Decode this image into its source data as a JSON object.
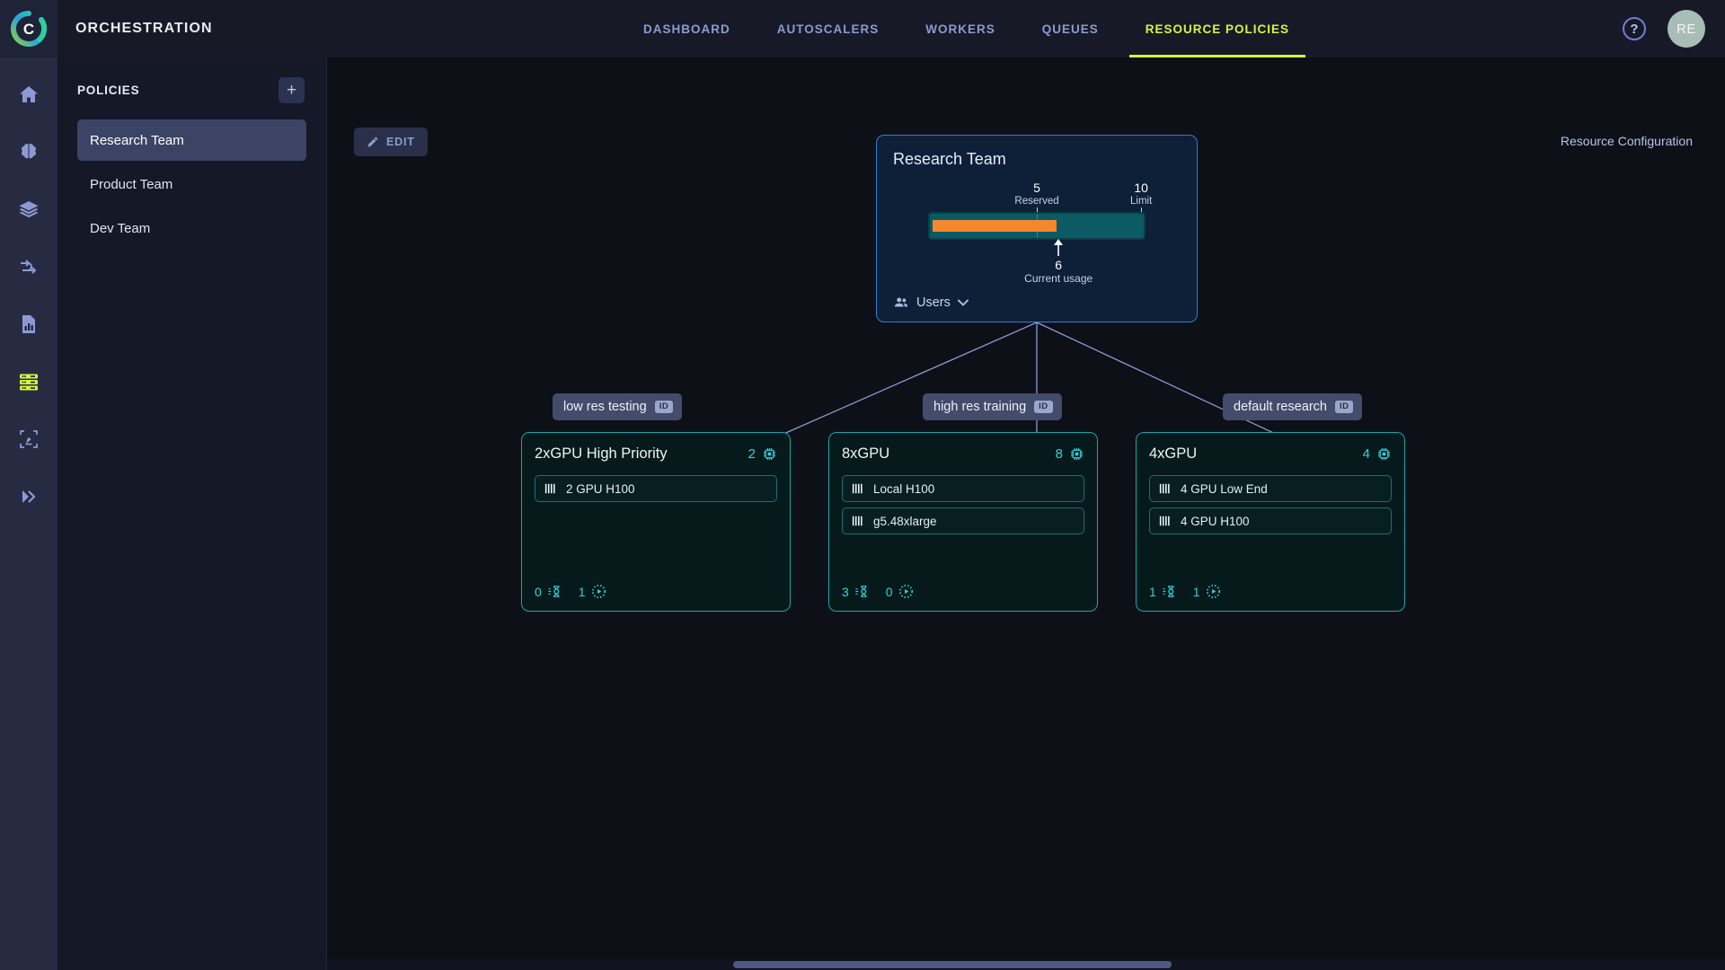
{
  "header": {
    "logo_icon": "brand-c-logo-icon",
    "title": "ORCHESTRATION",
    "tabs": [
      {
        "label": "DASHBOARD",
        "active": false
      },
      {
        "label": "AUTOSCALERS",
        "active": false
      },
      {
        "label": "WORKERS",
        "active": false
      },
      {
        "label": "QUEUES",
        "active": false
      },
      {
        "label": "RESOURCE POLICIES",
        "active": true
      }
    ],
    "help_label": "?",
    "avatar_initials": "RE",
    "accent_color": "#d6f53c"
  },
  "rail": {
    "items": [
      {
        "icon": "home-icon",
        "active": false
      },
      {
        "icon": "brain-icon",
        "active": false
      },
      {
        "icon": "layers-icon",
        "active": false
      },
      {
        "icon": "workflow-icon",
        "active": false
      },
      {
        "icon": "report-chart-icon",
        "active": false
      },
      {
        "icon": "server-rack-icon",
        "active": true
      },
      {
        "icon": "image-annotate-icon",
        "active": false
      },
      {
        "icon": "double-chevron-right-icon",
        "active": false
      }
    ]
  },
  "sidebar": {
    "title": "POLICIES",
    "add_label": "+",
    "items": [
      {
        "label": "Research Team",
        "active": true
      },
      {
        "label": "Product Team",
        "active": false
      },
      {
        "label": "Dev Team",
        "active": false
      }
    ]
  },
  "toolbar": {
    "edit_label": "EDIT",
    "edit_icon": "pencil-icon",
    "resource_configuration_label": "Resource Configuration"
  },
  "graph": {
    "parent": {
      "name": "Research Team",
      "reserved_value": "5",
      "reserved_caption": "Reserved",
      "limit_value": "10",
      "limit_caption": "Limit",
      "current_usage_value": "6",
      "current_usage_caption": "Current usage",
      "users_label": "Users",
      "users_icon": "users-group-icon",
      "chevron_icon": "chevron-down-icon",
      "bar_fill_color": "#f5882d",
      "bar_track_color": "#0c5a63",
      "border_color": "#2f7dd1"
    },
    "chips": [
      {
        "label": "low res testing",
        "badge": "ID"
      },
      {
        "label": "high res training",
        "badge": "ID"
      },
      {
        "label": "default research",
        "badge": "ID"
      }
    ],
    "pools": [
      {
        "name": "2xGPU High Priority",
        "gpu_count": "2",
        "gpu_icon": "cpu-chip-icon",
        "rows": [
          {
            "label": "2 GPU H100",
            "icon": "gpu-bars-icon"
          }
        ],
        "pending_count": "0",
        "pending_icon": "queued-hourglass-icon",
        "running_count": "1",
        "running_icon": "running-play-icon"
      },
      {
        "name": "8xGPU",
        "gpu_count": "8",
        "gpu_icon": "cpu-chip-icon",
        "rows": [
          {
            "label": "Local H100",
            "icon": "gpu-bars-icon"
          },
          {
            "label": "g5.48xlarge",
            "icon": "gpu-bars-icon"
          }
        ],
        "pending_count": "3",
        "pending_icon": "queued-hourglass-icon",
        "running_count": "0",
        "running_icon": "running-play-icon"
      },
      {
        "name": "4xGPU",
        "gpu_count": "4",
        "gpu_icon": "cpu-chip-icon",
        "rows": [
          {
            "label": "4 GPU Low End",
            "icon": "gpu-bars-icon"
          },
          {
            "label": "4 GPU H100",
            "icon": "gpu-bars-icon"
          }
        ],
        "pending_count": "1",
        "pending_icon": "queued-hourglass-icon",
        "running_count": "1",
        "running_icon": "running-play-icon"
      }
    ]
  }
}
